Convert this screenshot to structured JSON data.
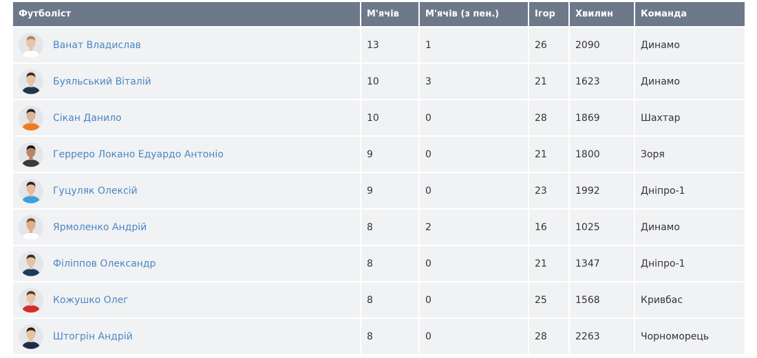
{
  "table": {
    "headers": {
      "player": "Футболіст",
      "goals": "М'ячів",
      "penalty_goals": "М'ячів (з пен.)",
      "games": "Ігор",
      "minutes": "Хвилин",
      "team": "Команда"
    },
    "rows": [
      {
        "name": "Ванат Владислав",
        "goals": "13",
        "penalty": "1",
        "games": "26",
        "minutes": "2090",
        "team": "Динамо",
        "shirt": "#ffffff",
        "skin": "#e8c4a8",
        "hair": "#a8845a"
      },
      {
        "name": "Буяльський Віталій",
        "goals": "10",
        "penalty": "3",
        "games": "21",
        "minutes": "1623",
        "team": "Динамо",
        "shirt": "#1f3550",
        "skin": "#e6c2a4",
        "hair": "#3b2a20"
      },
      {
        "name": "Сікан Данило",
        "goals": "10",
        "penalty": "0",
        "games": "28",
        "minutes": "1869",
        "team": "Шахтар",
        "shirt": "#f07a1e",
        "skin": "#dcb596",
        "hair": "#2e2118"
      },
      {
        "name": "Герреро Локано Едуардо Антоніо",
        "goals": "9",
        "penalty": "0",
        "games": "21",
        "minutes": "1800",
        "team": "Зоря",
        "shirt": "#3a3a3a",
        "skin": "#b7866a",
        "hair": "#1c1410"
      },
      {
        "name": "Гуцуляк Олексій",
        "goals": "9",
        "penalty": "0",
        "games": "23",
        "minutes": "1992",
        "team": "Дніпро-1",
        "shirt": "#3aa0e0",
        "skin": "#e2bc9c",
        "hair": "#2b1f16"
      },
      {
        "name": "Ярмоленко Андрій",
        "goals": "8",
        "penalty": "2",
        "games": "16",
        "minutes": "1025",
        "team": "Динамо",
        "shirt": "#ffffff",
        "skin": "#dcb08c",
        "hair": "#6e5132"
      },
      {
        "name": "Філіппов Олександр",
        "goals": "8",
        "penalty": "0",
        "games": "21",
        "minutes": "1347",
        "team": "Дніпро-1",
        "shirt": "#1d3c5c",
        "skin": "#e6c2a4",
        "hair": "#3b2a20"
      },
      {
        "name": "Кожушко Олег",
        "goals": "8",
        "penalty": "0",
        "games": "25",
        "minutes": "1568",
        "team": "Кривбас",
        "shirt": "#d62c2c",
        "skin": "#e8c4a8",
        "hair": "#5a3a22"
      },
      {
        "name": "Штогрін Андрій",
        "goals": "8",
        "penalty": "0",
        "games": "28",
        "minutes": "2263",
        "team": "Чорноморець",
        "shirt": "#1e2c48",
        "skin": "#e6c2a4",
        "hair": "#2b1f16"
      }
    ]
  },
  "icons": {
    "avatar": "player-avatar-icon"
  }
}
